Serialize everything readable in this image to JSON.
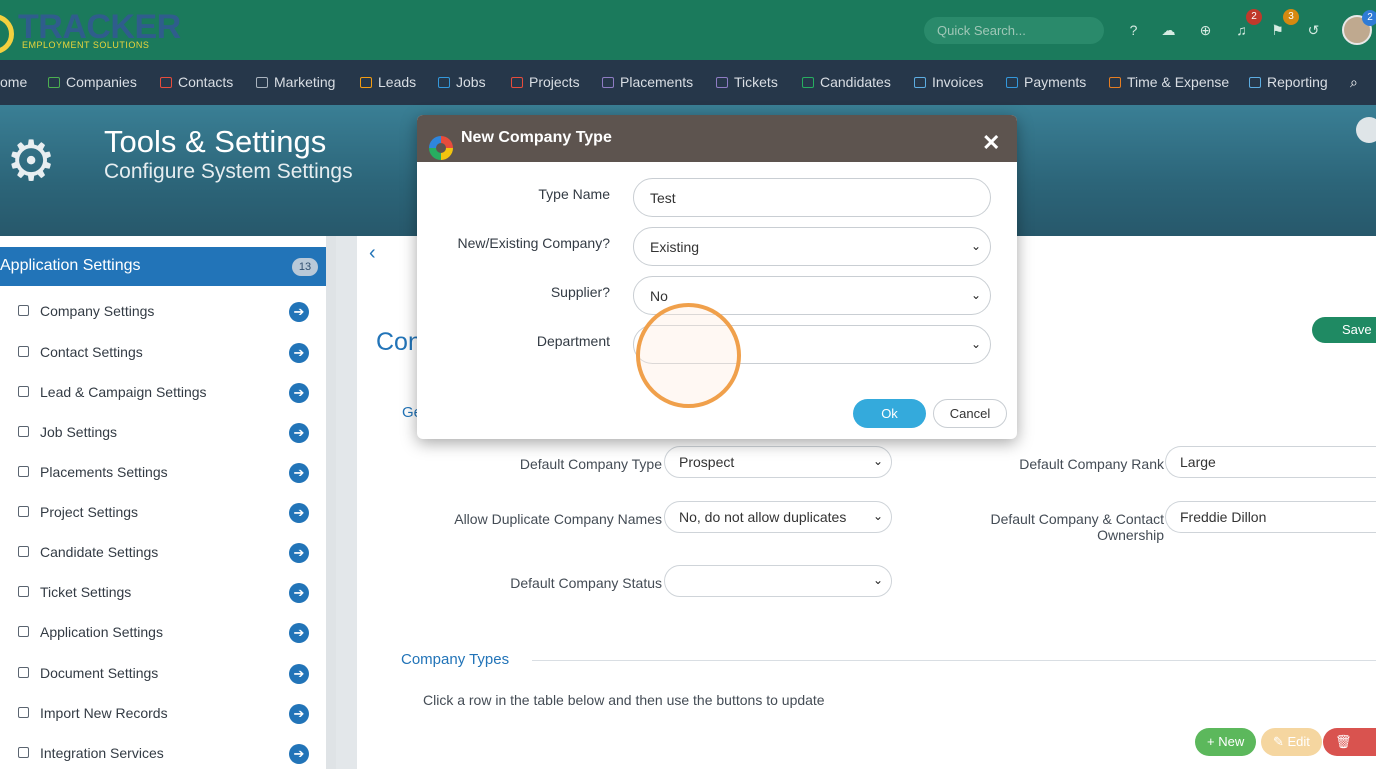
{
  "header": {
    "logo_text": "TRACKER",
    "logo_sub": "EMPLOYMENT SOLUTIONS",
    "search_placeholder": "Quick Search...",
    "badges": {
      "notifications": "2",
      "flags": "3",
      "avatar": "2"
    },
    "colors": {
      "brand": "#1b7a5c",
      "accent": "#2274b8"
    }
  },
  "nav": {
    "items": [
      "ome",
      "Companies",
      "Contacts",
      "Marketing",
      "Leads",
      "Jobs",
      "Projects",
      "Placements",
      "Tickets",
      "Candidates",
      "Invoices",
      "Payments",
      "Time & Expense",
      "Reporting"
    ]
  },
  "banner": {
    "title": "Tools & Settings",
    "subtitle": "Configure System Settings"
  },
  "sidebar": {
    "title": "Application Settings",
    "count": "13",
    "items": [
      "Company Settings",
      "Contact Settings",
      "Lead & Campaign Settings",
      "Job Settings",
      "Placements Settings",
      "Project Settings",
      "Candidate Settings",
      "Ticket Settings",
      "Application Settings",
      "Document Settings",
      "Import New Records",
      "Integration Services"
    ]
  },
  "main": {
    "title_partial": "Con",
    "save_label": "Save S",
    "general_partial": "Ge",
    "fields": {
      "default_company_type_label": "Default Company Type",
      "default_company_type_value": "Prospect",
      "allow_duplicates_label": "Allow Duplicate Company Names",
      "allow_duplicates_value": "No, do not allow duplicates",
      "default_status_label": "Default Company Status",
      "default_status_value": "",
      "default_rank_label": "Default Company Rank",
      "default_rank_value": "Large",
      "ownership_label": "Default Company & Contact Ownership",
      "ownership_value": "Freddie Dillon"
    },
    "company_types_title": "Company Types",
    "hint": "Click a row in the table below and then use the buttons to update",
    "buttons": {
      "new": "+ New",
      "edit": "✎ Edit",
      "delete": "🗑 Delet"
    }
  },
  "modal": {
    "title": "New Company Type",
    "type_name_label": "Type Name",
    "type_name_value": "Test",
    "new_existing_label": "New/Existing Company?",
    "new_existing_value": "Existing",
    "supplier_label": "Supplier?",
    "supplier_value": "No",
    "department_label": "Department",
    "department_value": "",
    "ok_label": "Ok",
    "cancel_label": "Cancel"
  }
}
